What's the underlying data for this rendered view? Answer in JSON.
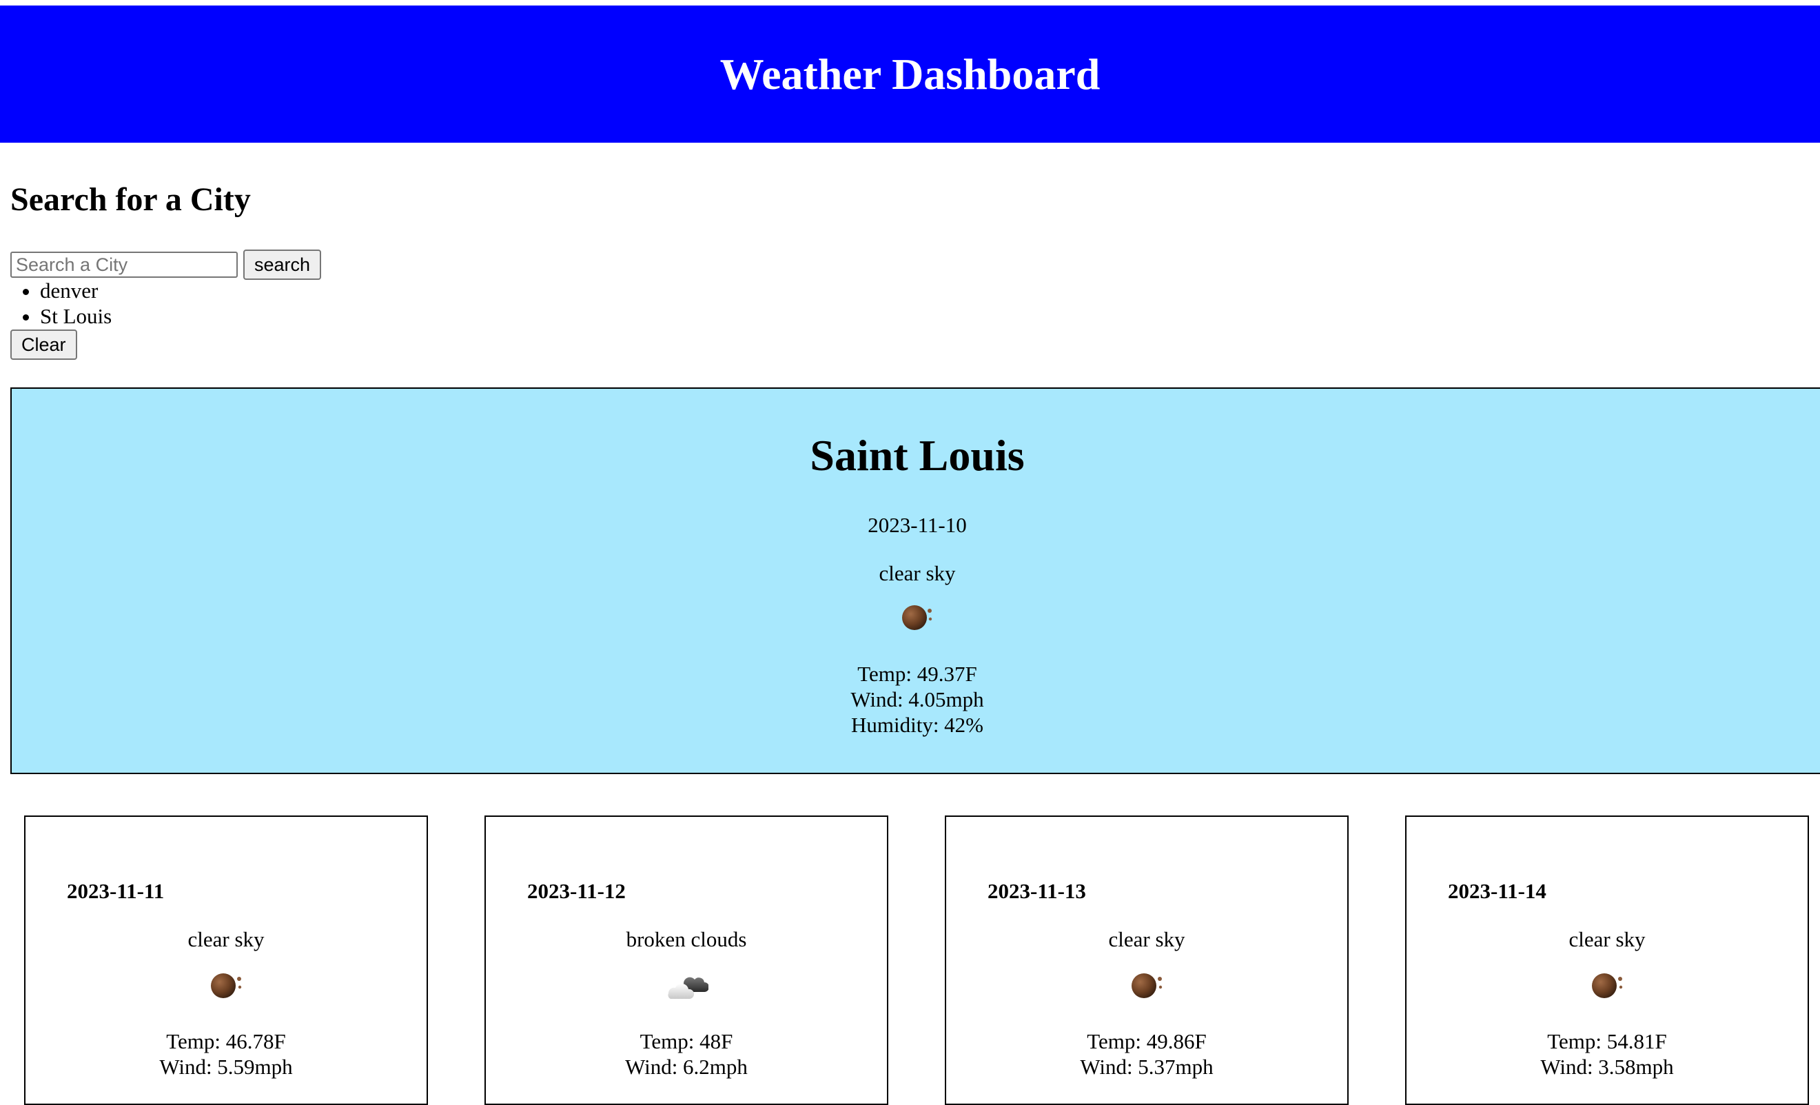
{
  "header": {
    "title": "Weather Dashboard"
  },
  "search": {
    "heading": "Search for a City",
    "placeholder": "Search a City",
    "value": "",
    "button_label": "search",
    "history": [
      "denver",
      "St Louis"
    ],
    "clear_label": "Clear"
  },
  "current": {
    "city": "Saint Louis",
    "date": "2023-11-10",
    "description": "clear sky",
    "icon": "clear-night-icon",
    "temp": "Temp: 49.37F",
    "wind": "Wind: 4.05mph",
    "humidity": "Humidity: 42%"
  },
  "forecast": [
    {
      "date": "2023-11-11",
      "description": "clear sky",
      "icon": "clear-night-icon",
      "temp": "Temp: 46.78F",
      "wind": "Wind: 5.59mph"
    },
    {
      "date": "2023-11-12",
      "description": "broken clouds",
      "icon": "broken-clouds-icon",
      "temp": "Temp: 48F",
      "wind": "Wind: 6.2mph"
    },
    {
      "date": "2023-11-13",
      "description": "clear sky",
      "icon": "clear-night-icon",
      "temp": "Temp: 49.86F",
      "wind": "Wind: 5.37mph"
    },
    {
      "date": "2023-11-14",
      "description": "clear sky",
      "icon": "clear-night-icon",
      "temp": "Temp: 54.81F",
      "wind": "Wind: 3.58mph"
    }
  ],
  "colors": {
    "header_bg": "#0000ff",
    "current_bg": "#a8e8fd"
  }
}
